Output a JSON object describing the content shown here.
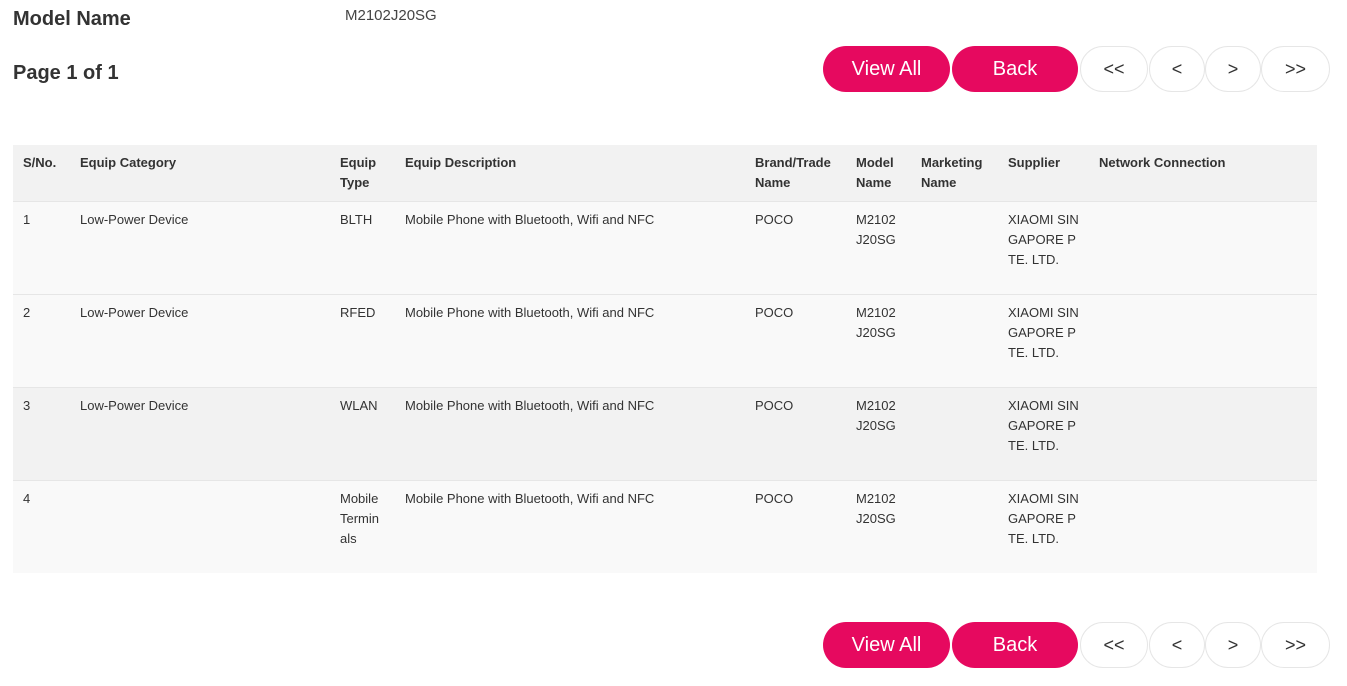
{
  "header": {
    "model_label": "Model Name",
    "model_value": "M2102J20SG",
    "page_info": "Page 1 of 1"
  },
  "pager": {
    "view_all": "View All",
    "back": "Back",
    "first": "<<",
    "prev": "<",
    "next": ">",
    "last": ">>"
  },
  "colors": {
    "accent": "#e6095f"
  },
  "table": {
    "columns": [
      "S/No.",
      "Equip Category",
      "Equip Type",
      "Equip Description",
      "Brand/Trade Name",
      "Model Name",
      "Marketing Name",
      "Supplier",
      "Network Connection"
    ],
    "rows": [
      [
        "1",
        "Low-Power Device",
        "BLTH",
        "Mobile Phone with Bluetooth, Wifi and NFC",
        "POCO",
        "M2102J20SG",
        "",
        "XIAOMI SINGAPORE PTE. LTD.",
        ""
      ],
      [
        "2",
        "Low-Power Device",
        "RFED",
        "Mobile Phone with Bluetooth, Wifi and NFC",
        "POCO",
        "M2102J20SG",
        "",
        "XIAOMI SINGAPORE PTE. LTD.",
        ""
      ],
      [
        "3",
        "Low-Power Device",
        "WLAN",
        "Mobile Phone with Bluetooth, Wifi and NFC",
        "POCO",
        "M2102J20SG",
        "",
        "XIAOMI SINGAPORE PTE. LTD.",
        ""
      ],
      [
        "4",
        "",
        "Mobile Terminals",
        "Mobile Phone with Bluetooth, Wifi and NFC",
        "POCO",
        "M2102J20SG",
        "",
        "XIAOMI SINGAPORE PTE. LTD.",
        ""
      ]
    ]
  }
}
